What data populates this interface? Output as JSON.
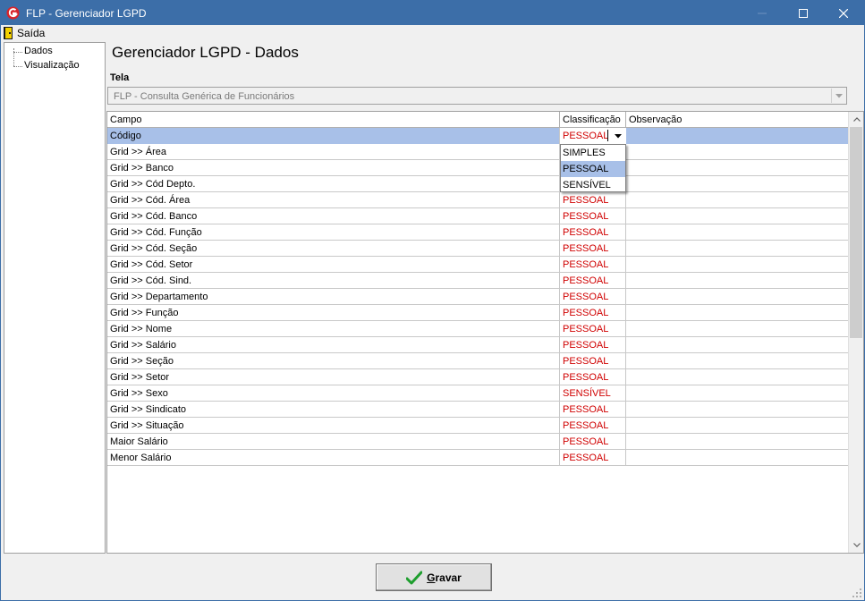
{
  "window": {
    "title": "FLP - Gerenciador LGPD",
    "icons": {
      "app": "flp-logo-icon",
      "minimize": "minimize-icon",
      "maximize": "maximize-icon",
      "close": "close-icon"
    },
    "titlebar_color": "#3c6ea8"
  },
  "menu": {
    "exit_label": "Saída",
    "exit_icon": "door-exit-icon"
  },
  "sidebar": {
    "items": [
      {
        "label": "Dados"
      },
      {
        "label": "Visualização"
      }
    ]
  },
  "main": {
    "title": "Gerenciador LGPD - Dados",
    "tela_label": "Tela",
    "tela_value": "FLP - Consulta Genérica de Funcionários"
  },
  "grid": {
    "columns": [
      "Campo",
      "Classificação",
      "Observação"
    ],
    "rows": [
      {
        "campo": "Código",
        "classificacao": "PESSOAL",
        "observacao": ""
      },
      {
        "campo": "Grid >> Área",
        "classificacao": "",
        "observacao": ""
      },
      {
        "campo": "Grid >> Banco",
        "classificacao": "",
        "observacao": ""
      },
      {
        "campo": "Grid >> Cód Depto.",
        "classificacao": "",
        "observacao": ""
      },
      {
        "campo": "Grid >> Cód. Área",
        "classificacao": "PESSOAL",
        "observacao": ""
      },
      {
        "campo": "Grid >> Cód. Banco",
        "classificacao": "PESSOAL",
        "observacao": ""
      },
      {
        "campo": "Grid >> Cód. Função",
        "classificacao": "PESSOAL",
        "observacao": ""
      },
      {
        "campo": "Grid >> Cód. Seção",
        "classificacao": "PESSOAL",
        "observacao": ""
      },
      {
        "campo": "Grid >> Cód. Setor",
        "classificacao": "PESSOAL",
        "observacao": ""
      },
      {
        "campo": "Grid >> Cód. Sind.",
        "classificacao": "PESSOAL",
        "observacao": ""
      },
      {
        "campo": "Grid >> Departamento",
        "classificacao": "PESSOAL",
        "observacao": ""
      },
      {
        "campo": "Grid >> Função",
        "classificacao": "PESSOAL",
        "observacao": ""
      },
      {
        "campo": "Grid >> Nome",
        "classificacao": "PESSOAL",
        "observacao": ""
      },
      {
        "campo": "Grid >> Salário",
        "classificacao": "PESSOAL",
        "observacao": ""
      },
      {
        "campo": "Grid >> Seção",
        "classificacao": "PESSOAL",
        "observacao": ""
      },
      {
        "campo": "Grid >> Setor",
        "classificacao": "PESSOAL",
        "observacao": ""
      },
      {
        "campo": "Grid >> Sexo",
        "classificacao": "SENSÍVEL",
        "observacao": ""
      },
      {
        "campo": "Grid >> Sindicato",
        "classificacao": "PESSOAL",
        "observacao": ""
      },
      {
        "campo": "Grid >> Situação",
        "classificacao": "PESSOAL",
        "observacao": ""
      },
      {
        "campo": "Maior Salário",
        "classificacao": "PESSOAL",
        "observacao": ""
      },
      {
        "campo": "Menor Salário",
        "classificacao": "PESSOAL",
        "observacao": ""
      }
    ],
    "editor_value": "PESSOAL",
    "dropdown_options": [
      "SIMPLES",
      "PESSOAL",
      "SENSÍVEL"
    ],
    "dropdown_selected": "PESSOAL",
    "selection_color": "#a8c0e8",
    "classification_color": "#d00000"
  },
  "footer": {
    "save_label_underlined": "G",
    "save_label_rest": "ravar",
    "save_icon": "green-check-icon"
  }
}
